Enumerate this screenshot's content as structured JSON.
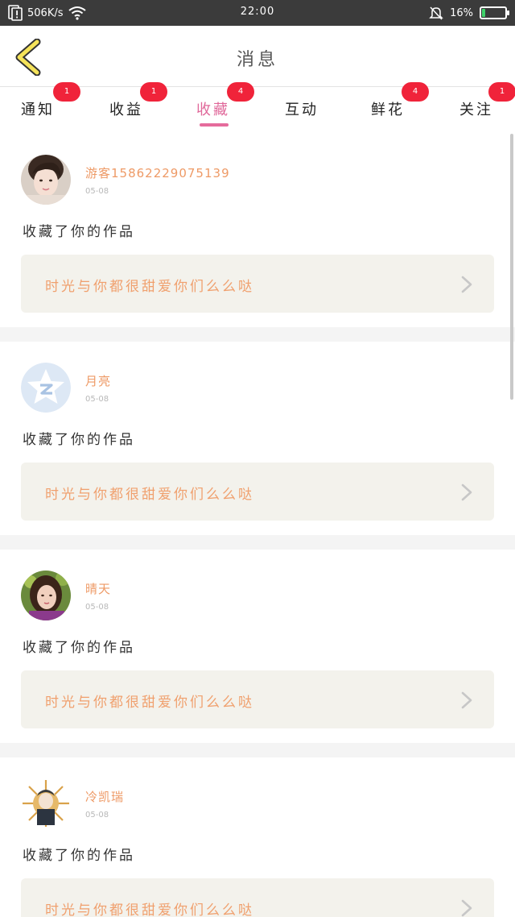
{
  "status_bar": {
    "speed": "506K/s",
    "time": "22:00",
    "battery": "16%",
    "battery_level": 0.16
  },
  "header": {
    "title": "消息"
  },
  "tabs": [
    {
      "label": "通知",
      "badge": "1"
    },
    {
      "label": "收益",
      "badge": "1"
    },
    {
      "label": "收藏",
      "badge": "4",
      "active": true
    },
    {
      "label": "互动",
      "badge": ""
    },
    {
      "label": "鲜花",
      "badge": "4"
    },
    {
      "label": "关注",
      "badge": "1"
    }
  ],
  "messages": [
    {
      "username": "游客15862229075139",
      "date": "05-08",
      "action": "收藏了你的作品",
      "work_title": "时光与你都很甜爱你们么么哒",
      "avatar": "girl-avatar"
    },
    {
      "username": "月亮",
      "date": "05-08",
      "action": "收藏了你的作品",
      "work_title": "时光与你都很甜爱你们么么哒",
      "avatar": "default-star-avatar"
    },
    {
      "username": "晴天",
      "date": "05-08",
      "action": "收藏了你的作品",
      "work_title": "时光与你都很甜爱你们么么哒",
      "avatar": "woman-avatar"
    },
    {
      "username": "冷凯瑞",
      "date": "05-08",
      "action": "收藏了你的作品",
      "work_title": "时光与你都很甜爱你们么么哒",
      "avatar": "warrior-avatar"
    }
  ],
  "colors": {
    "accent": "#e56b9c",
    "badge": "#f0233a",
    "username": "#ee9a66",
    "work_title": "#f0a06e",
    "work_bg": "#f3f2ec"
  }
}
